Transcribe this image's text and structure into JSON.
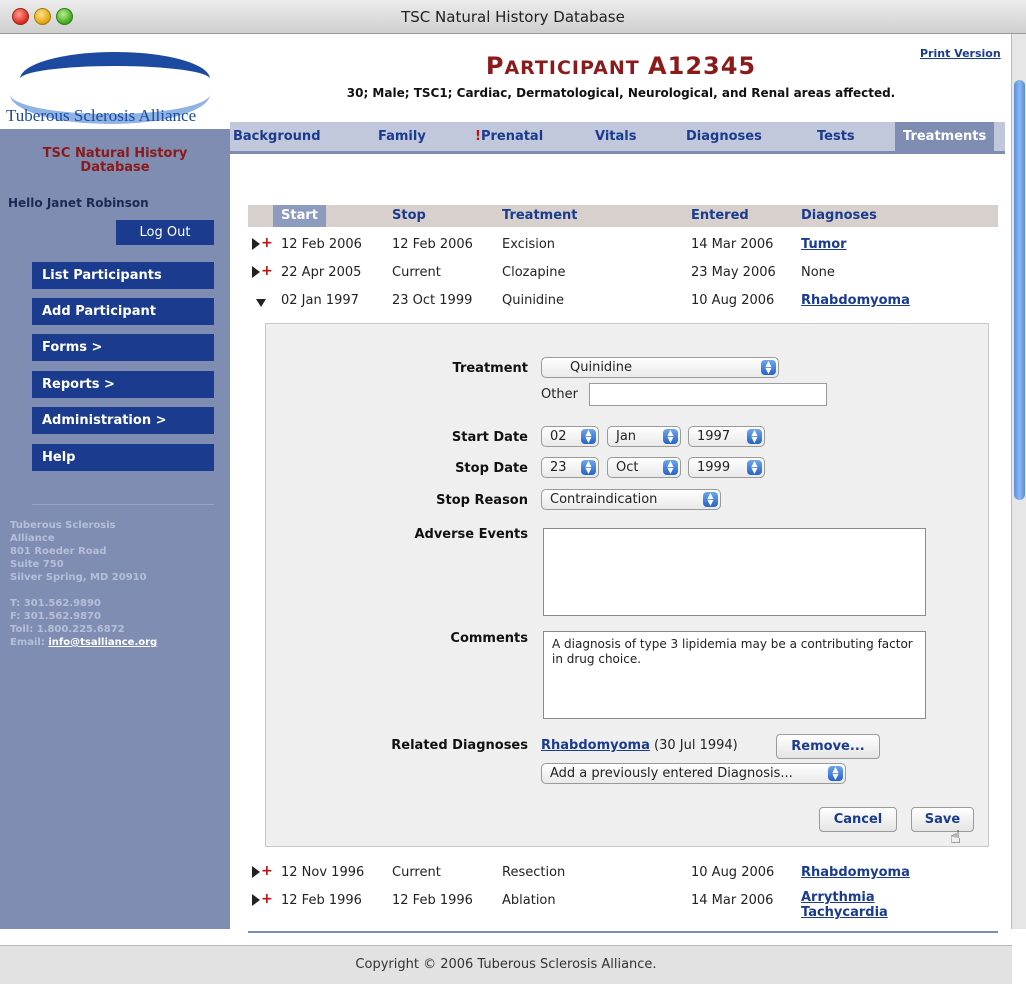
{
  "window": {
    "title": "TSC Natural History Database"
  },
  "sidebar": {
    "logo_text": "Tuberous Sclerosis Alliance",
    "app_title_line1": "TSC Natural History",
    "app_title_line2": "Database",
    "greeting": "Hello Janet Robinson",
    "logout": "Log Out",
    "nav": [
      "List Participants",
      "Add Participant",
      "Forms >",
      "Reports >",
      "Administration >",
      "Help"
    ],
    "address": [
      "Tuberous Sclerosis",
      "Alliance",
      "801 Roeder Road",
      "Suite 750",
      "Silver Spring, MD 20910"
    ],
    "phone": "T: 301.562.9890",
    "fax": "F: 301.562.9870",
    "tollfree": "Toll: 1.800.225.6872",
    "email_label": "Email:",
    "email": "info@tsalliance.org"
  },
  "participant": {
    "title_first": "P",
    "title_rest": "ARTICIPANT",
    "id": "A12345",
    "summary": "30; Male; TSC1; Cardiac, Dermatological, Neurological, and Renal areas affected.",
    "print_version": "Print Version"
  },
  "tabs": [
    {
      "label": "Background"
    },
    {
      "label": "Family"
    },
    {
      "label": "Prenatal",
      "flag": "!"
    },
    {
      "label": "Vitals"
    },
    {
      "label": "Diagnoses"
    },
    {
      "label": "Tests"
    },
    {
      "label": "Treatments",
      "active": true
    }
  ],
  "table": {
    "columns": [
      "Start",
      "Stop",
      "Treatment",
      "Entered",
      "Diagnoses"
    ],
    "rows": [
      {
        "start": "12 Feb 2006",
        "stop": "12 Feb 2006",
        "treatment": "Excision",
        "entered": "14 Mar 2006",
        "diagnoses": "Tumor",
        "diag_link": true,
        "state": "collapsed"
      },
      {
        "start": "22 Apr 2005",
        "stop": "Current",
        "treatment": "Clozapine",
        "entered": "23 May 2006",
        "diagnoses": "None",
        "diag_link": false,
        "state": "collapsed"
      },
      {
        "start": "02 Jan 1997",
        "stop": "23 Oct 1999",
        "treatment": "Quinidine",
        "entered": "10 Aug 2006",
        "diagnoses": "Rhabdomyoma",
        "diag_link": true,
        "state": "expanded"
      },
      {
        "start": "12 Nov 1996",
        "stop": "Current",
        "treatment": "Resection",
        "entered": "10 Aug 2006",
        "diagnoses": "Rhabdomyoma",
        "diag_link": true,
        "state": "collapsed"
      },
      {
        "start": "12 Feb 1996",
        "stop": "12 Feb 1996",
        "treatment": "Ablation",
        "entered": "14 Mar 2006",
        "diagnoses": "Arrythmia",
        "diagnoses2": "Tachycardia",
        "diag_link": true,
        "state": "collapsed"
      }
    ]
  },
  "form": {
    "treatment_label": "Treatment",
    "treatment_value": "Quinidine",
    "other_label": "Other",
    "other_value": "",
    "start_label": "Start Date",
    "start_day": "02",
    "start_month": "Jan",
    "start_year": "1997",
    "stop_label": "Stop Date",
    "stop_day": "23",
    "stop_month": "Oct",
    "stop_year": "1999",
    "stop_reason_label": "Stop Reason",
    "stop_reason_value": "Contraindication",
    "adverse_label": "Adverse Events",
    "adverse_value": "",
    "comments_label": "Comments",
    "comments_value": "A diagnosis of type 3 lipidemia may be a contributing factor in drug choice.",
    "related_label": "Related Diagnoses",
    "related_link": "Rhabdomyoma",
    "related_date": "(30 Jul 1994)",
    "remove": "Remove...",
    "add_diag": "Add a previously entered Diagnosis...",
    "cancel": "Cancel",
    "save": "Save"
  },
  "footer": {
    "text": "Copyright © 2006 Tuberous Sclerosis Alliance."
  }
}
